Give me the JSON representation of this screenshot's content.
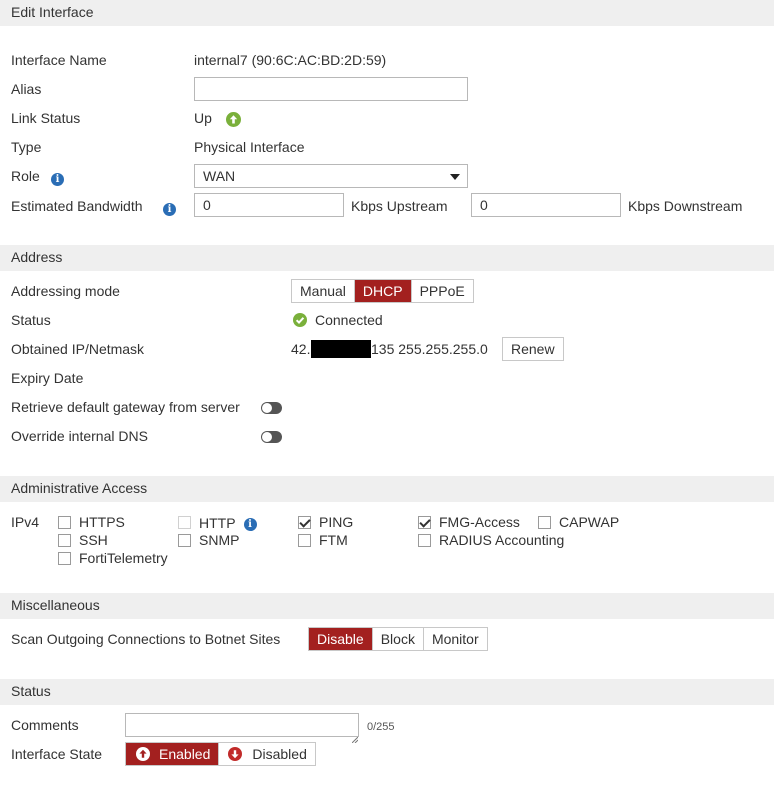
{
  "edit": {
    "title": "Edit Interface",
    "interface_name_label": "Interface Name",
    "interface_name_value": "internal7 (90:6C:AC:BD:2D:59)",
    "alias_label": "Alias",
    "alias_value": "",
    "link_status_label": "Link Status",
    "link_status_value": "Up",
    "type_label": "Type",
    "type_value": "Physical Interface",
    "role_label": "Role",
    "role_value": "WAN",
    "bandwidth_label": "Estimated Bandwidth",
    "upstream_value": "0",
    "upstream_unit": "Kbps Upstream",
    "downstream_value": "0",
    "downstream_unit": "Kbps Downstream"
  },
  "address": {
    "title": "Address",
    "mode_label": "Addressing mode",
    "modes": [
      "Manual",
      "DHCP",
      "PPPoE"
    ],
    "active_mode": "DHCP",
    "status_label": "Status",
    "status_value": "Connected",
    "ip_label": "Obtained IP/Netmask",
    "ip_prefix": "42.",
    "ip_suffix": "135 255.255.255.0",
    "renew_label": "Renew",
    "expiry_label": "Expiry Date",
    "gateway_label": "Retrieve default gateway from server",
    "gateway_enabled": false,
    "dns_label": "Override internal DNS",
    "dns_enabled": false
  },
  "admin": {
    "title": "Administrative Access",
    "ipv4_label": "IPv4",
    "options": [
      {
        "label": "HTTPS",
        "checked": false,
        "disabled": false
      },
      {
        "label": "HTTP",
        "checked": false,
        "disabled": true
      },
      {
        "label": "PING",
        "checked": true,
        "disabled": false
      },
      {
        "label": "FMG-Access",
        "checked": true,
        "disabled": false
      },
      {
        "label": "CAPWAP",
        "checked": false,
        "disabled": false
      },
      {
        "label": "SSH",
        "checked": false,
        "disabled": false
      },
      {
        "label": "SNMP",
        "checked": false,
        "disabled": false
      },
      {
        "label": "FTM",
        "checked": false,
        "disabled": false
      },
      {
        "label": "RADIUS Accounting",
        "checked": false,
        "disabled": false
      },
      {
        "label": "FortiTelemetry",
        "checked": false,
        "disabled": false
      }
    ]
  },
  "misc": {
    "title": "Miscellaneous",
    "botnet_label": "Scan Outgoing Connections to Botnet Sites",
    "botnet_options": [
      "Disable",
      "Block",
      "Monitor"
    ],
    "botnet_active": "Disable"
  },
  "status": {
    "title": "Status",
    "comments_label": "Comments",
    "comments_value": "",
    "comments_count": "0/255",
    "state_label": "Interface State",
    "enabled_label": "Enabled",
    "disabled_label": "Disabled",
    "active_state": "Enabled"
  },
  "colors": {
    "accent": "#a3201f",
    "status_green": "#7ab03b",
    "info_blue": "#2a6db5",
    "header_bg": "#efefef"
  }
}
